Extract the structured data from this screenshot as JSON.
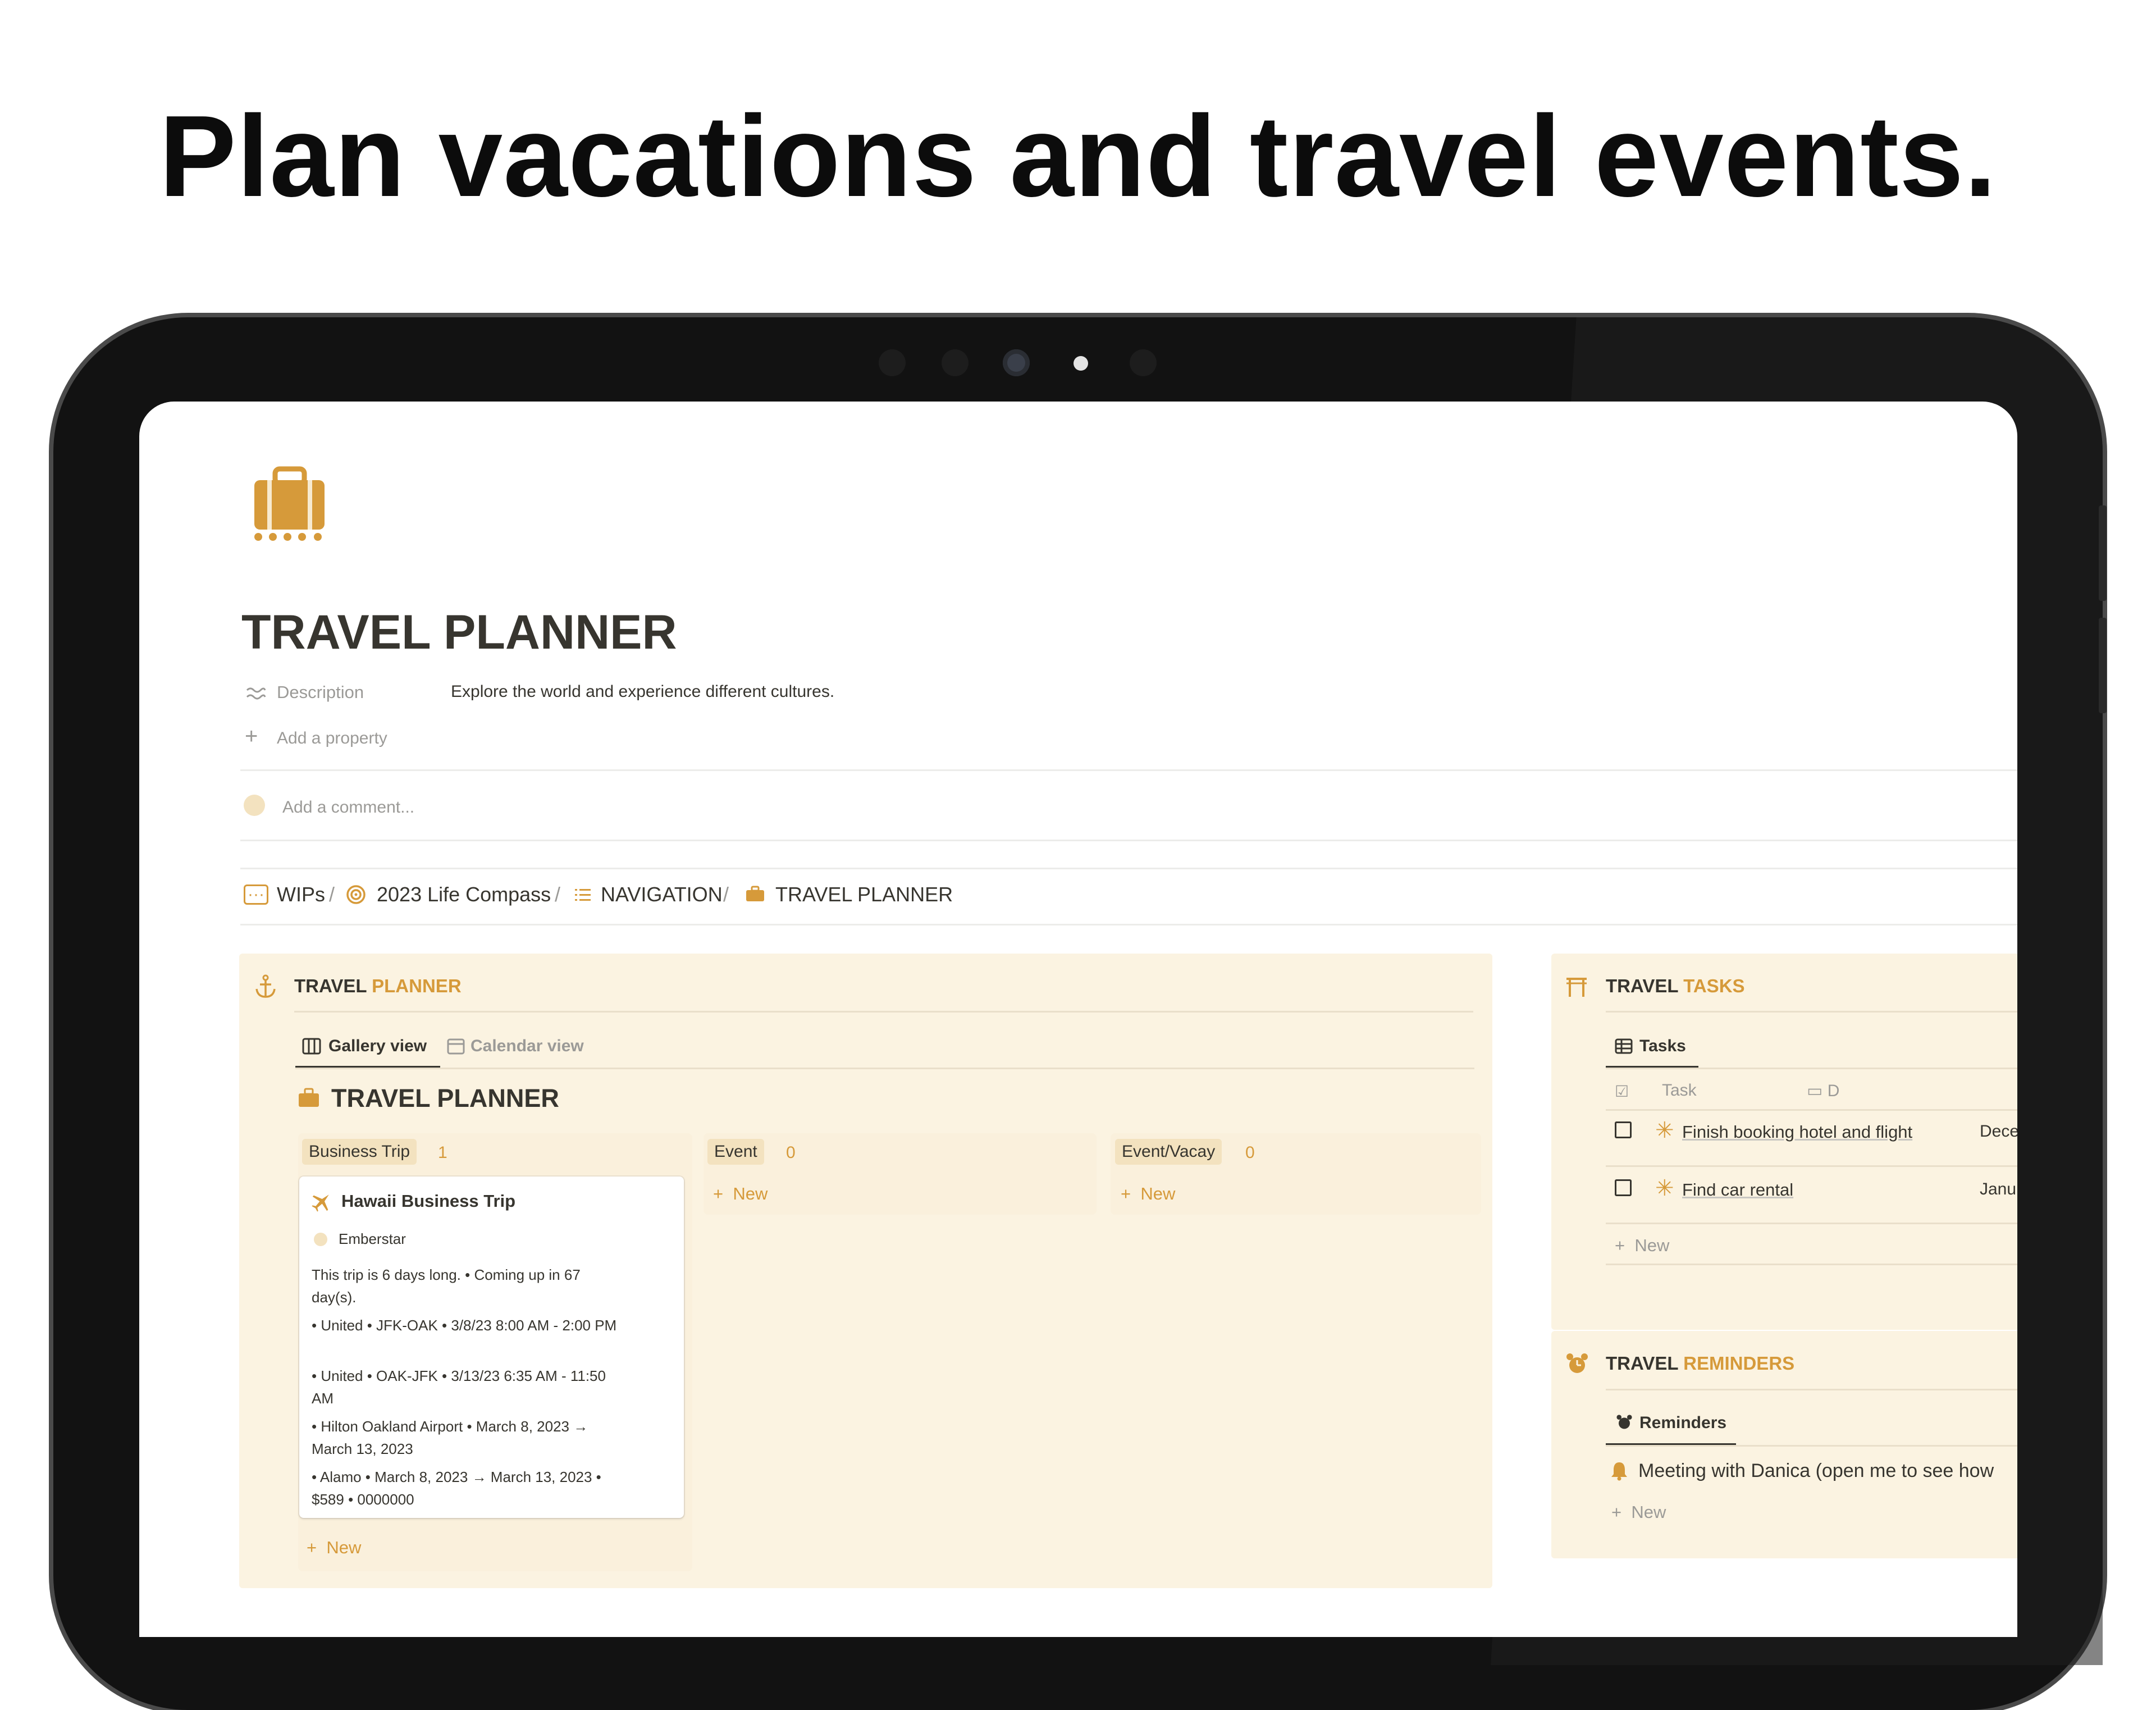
{
  "headline": "Plan vacations and travel events.",
  "page": {
    "title": "TRAVEL PLANNER",
    "description_label": "Description",
    "description_value": "Explore the world and experience different cultures.",
    "add_property": "Add a property",
    "add_comment": "Add a comment...",
    "accent_color": "#d69a3a",
    "panel_color": "#fbf3e1"
  },
  "breadcrumb": [
    {
      "label": "WIPs",
      "icon": "wip-icon"
    },
    {
      "label": "2023 Life Compass",
      "icon": "target-icon"
    },
    {
      "label": "NAVIGATION",
      "icon": "list-icon"
    },
    {
      "label": "TRAVEL PLANNER",
      "icon": "suitcase-icon"
    }
  ],
  "breadcrumb_separator": "/",
  "planner": {
    "heading_main": "TRAVEL",
    "heading_accent": "PLANNER",
    "tabs": [
      {
        "label": "Gallery view",
        "active": true
      },
      {
        "label": "Calendar view",
        "active": false
      }
    ],
    "db_title": "TRAVEL PLANNER",
    "columns": [
      {
        "name": "Business Trip",
        "count": "1",
        "new_label": "New"
      },
      {
        "name": "Event",
        "count": "0",
        "new_label": "New"
      },
      {
        "name": "Event/Vacay",
        "count": "0",
        "new_label": "New"
      }
    ],
    "card": {
      "title": "Hawaii Business Trip",
      "person": "Emberstar",
      "lines": [
        "This trip is 6 days long. • Coming up in 67 day(s).",
        "• United • JFK-OAK • 3/8/23 8:00 AM - 2:00 PM",
        "• United • OAK-JFK • 3/13/23 6:35 AM - 11:50 AM",
        "• Hilton Oakland Airport • March 8, 2023 → March 13, 2023",
        "• Alamo • March 8, 2023 → March 13, 2023 • $589 • 0000000"
      ]
    }
  },
  "tasks": {
    "heading_main": "TRAVEL",
    "heading_accent": "TASKS",
    "tab": "Tasks",
    "col_task": "Task",
    "col_date": "D",
    "rows": [
      {
        "name": "Finish booking hotel and flight",
        "date": "Dece"
      },
      {
        "name": "Find car rental",
        "date": "Janu"
      }
    ],
    "new_label": "New"
  },
  "reminders": {
    "heading_main": "TRAVEL",
    "heading_accent": "REMINDERS",
    "tab": "Reminders",
    "items": [
      "Meeting with Danica (open me to see how"
    ],
    "new_label": "New"
  }
}
